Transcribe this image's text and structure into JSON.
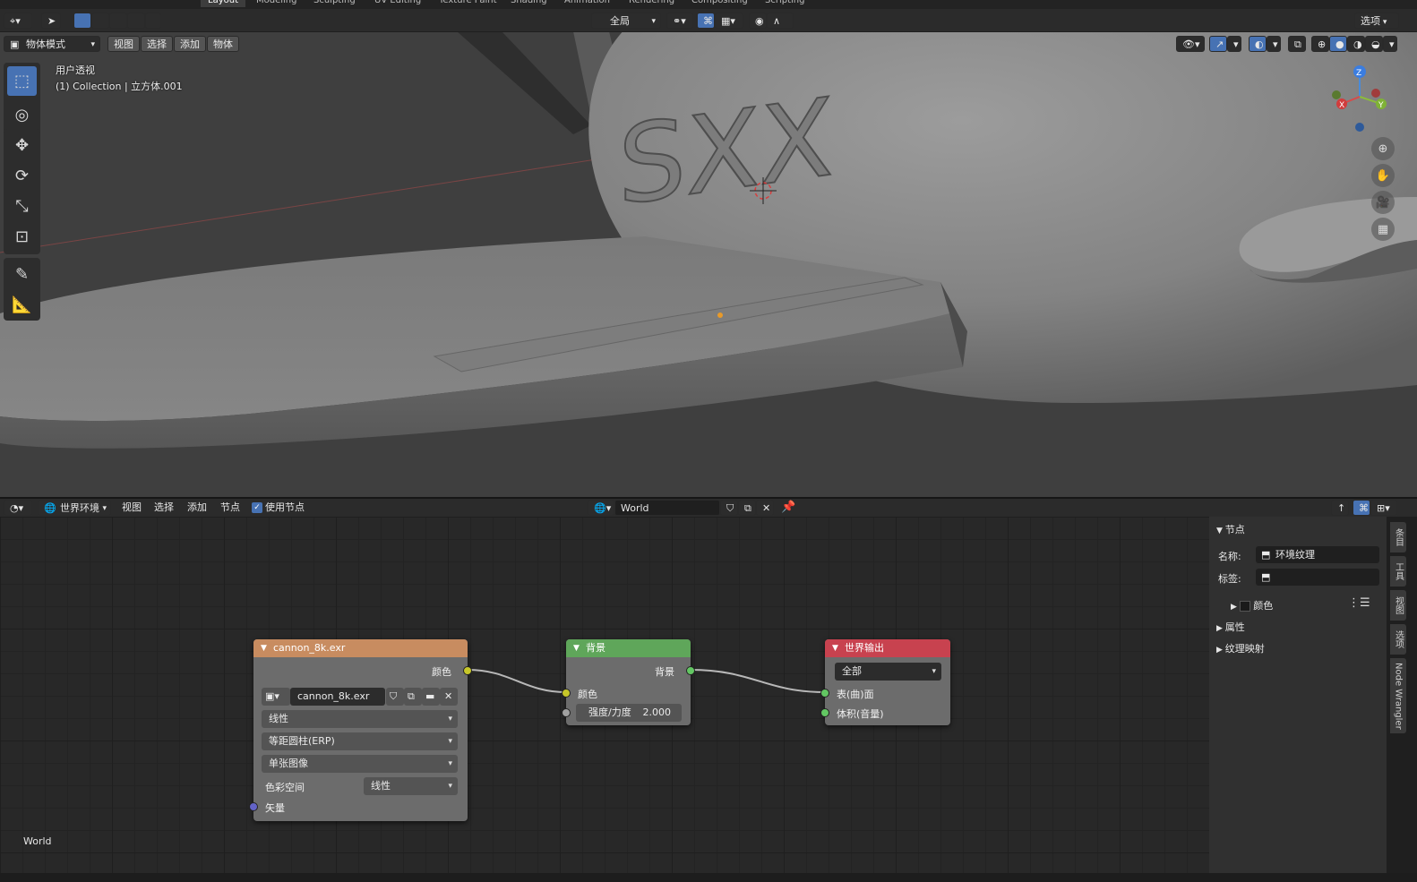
{
  "workspace_tabs": [
    "Layout",
    "Modeling",
    "Sculpting",
    "UV Editing",
    "Texture Paint",
    "Shading",
    "Animation",
    "Rendering",
    "Compositing",
    "Scripting"
  ],
  "active_tab": "Layout",
  "viewport": {
    "transform_orientation": "全局",
    "options_label": "选项",
    "mode": "物体模式",
    "menus": [
      "视图",
      "选择",
      "添加",
      "物体"
    ],
    "view_name": "用户透视",
    "collection_info": "(1) Collection | 立方体.001",
    "logo_text": "SXX",
    "gizmo": {
      "z": "Z",
      "y": "Y",
      "x": "X"
    }
  },
  "node_editor": {
    "shader_type": "世界环境",
    "menus": [
      "视图",
      "选择",
      "添加",
      "节点"
    ],
    "use_nodes_label": "使用节点",
    "use_nodes_checked": true,
    "world_name": "World",
    "canvas_label": "World",
    "nodes": {
      "env_texture": {
        "title": "cannon_8k.exr",
        "output_color": "颜色",
        "image_name": "cannon_8k.exr",
        "interpolation": "线性",
        "projection": "等距圆柱(ERP)",
        "source": "单张图像",
        "color_space_label": "色彩空间",
        "color_space": "线性",
        "input_vector": "矢量"
      },
      "background": {
        "title": "背景",
        "output": "背景",
        "input_color": "颜色",
        "strength_label": "强度/力度",
        "strength_value": "2.000"
      },
      "world_output": {
        "title": "世界输出",
        "target": "全部",
        "input_surface": "表(曲)面",
        "input_volume": "体积(音量)"
      }
    },
    "sidebar": {
      "section_node": "节点",
      "name_label": "名称:",
      "name_value": "环境纹理",
      "label_label": "标签:",
      "label_value": "",
      "color_label": "颜色",
      "properties_label": "属性",
      "texture_mapping_label": "纹理映射",
      "tabs": [
        "条目",
        "工具",
        "视图",
        "选项",
        "Node Wrangler"
      ]
    }
  },
  "colors": {
    "accent": "#4772b3",
    "texture_header": "#c88c60",
    "shader_header": "#5fa65a",
    "output_header": "#c8424f",
    "socket_color": "#c7c729",
    "socket_shader": "#63c763",
    "socket_vector": "#6363c7"
  }
}
